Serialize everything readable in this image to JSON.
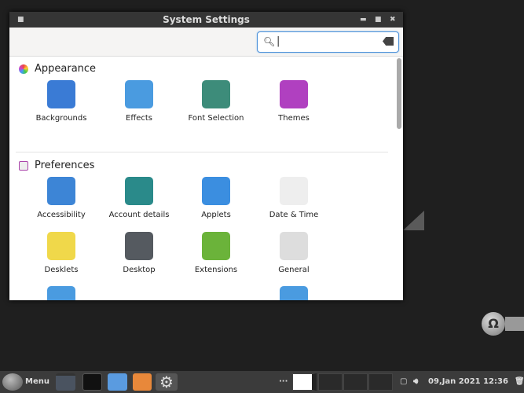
{
  "window": {
    "title": "System Settings"
  },
  "search": {
    "value": "",
    "placeholder": ""
  },
  "sections": [
    {
      "title": "Appearance",
      "items": [
        {
          "label": "Backgrounds",
          "icon": "backgrounds-icon",
          "color": "#3a7bd5"
        },
        {
          "label": "Effects",
          "icon": "effects-icon",
          "color": "#4a9be0"
        },
        {
          "label": "Font Selection",
          "icon": "font-selection-icon",
          "color": "#3d8c7a"
        },
        {
          "label": "Themes",
          "icon": "themes-icon",
          "color": "#b040c0"
        }
      ]
    },
    {
      "title": "Preferences",
      "items": [
        {
          "label": "Accessibility",
          "icon": "accessibility-icon",
          "color": "#3d85d6"
        },
        {
          "label": "Account details",
          "icon": "account-details-icon",
          "color": "#2a8a8a"
        },
        {
          "label": "Applets",
          "icon": "applets-icon",
          "color": "#3b8ee0"
        },
        {
          "label": "Date & Time",
          "icon": "clock-icon",
          "color": "#eeeeee"
        },
        {
          "label": "Desklets",
          "icon": "desklets-icon",
          "color": "#f0d84a"
        },
        {
          "label": "Desktop",
          "icon": "desktop-icon",
          "color": "#555a60"
        },
        {
          "label": "Extensions",
          "icon": "extensions-icon",
          "color": "#6bb33a"
        },
        {
          "label": "General",
          "icon": "general-icon",
          "color": "#ddd"
        }
      ]
    }
  ],
  "taskbar": {
    "menu_label": "Menu",
    "clock": "09,Jan 2021 12:36",
    "more": "···"
  }
}
